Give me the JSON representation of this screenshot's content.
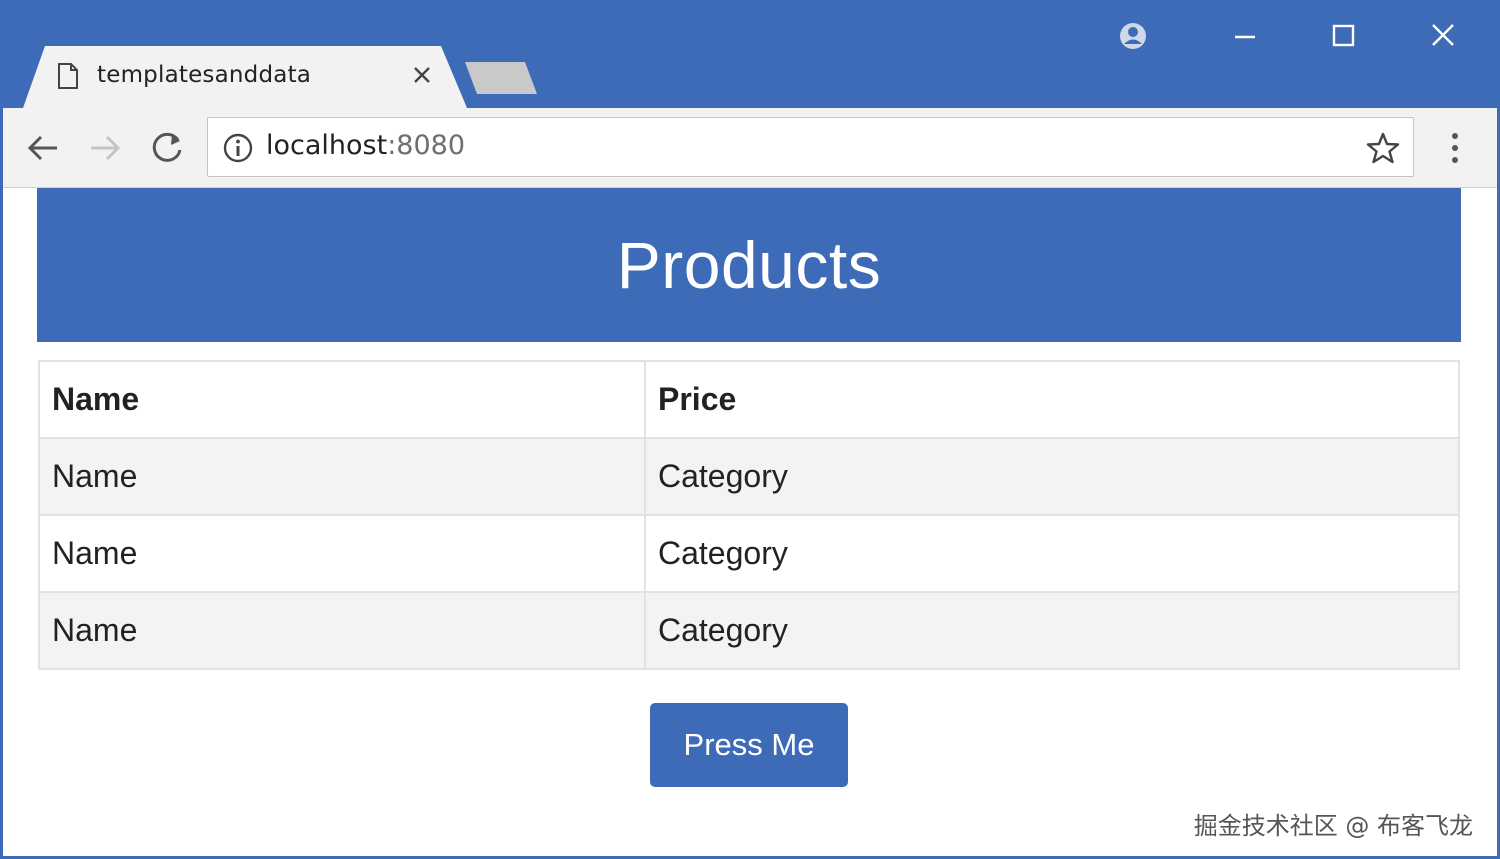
{
  "browser": {
    "tab_title": "templatesanddata",
    "url_host": "localhost",
    "url_port": ":8080",
    "icons": [
      "page-icon",
      "close-icon",
      "profile-icon",
      "minimize-icon",
      "maximize-icon",
      "close-window-icon",
      "back-icon",
      "forward-icon",
      "reload-icon",
      "info-icon",
      "star-icon",
      "menu-icon"
    ]
  },
  "page": {
    "title": "Products",
    "table": {
      "headers": [
        "Name",
        "Price"
      ],
      "rows": [
        [
          "Name",
          "Category"
        ],
        [
          "Name",
          "Category"
        ],
        [
          "Name",
          "Category"
        ]
      ]
    },
    "button_label": "Press Me",
    "watermark": "掘金技术社区 @ 布客飞龙"
  },
  "colors": {
    "accent": "#3d6bb7",
    "tab_bg": "#f2f2f2"
  }
}
